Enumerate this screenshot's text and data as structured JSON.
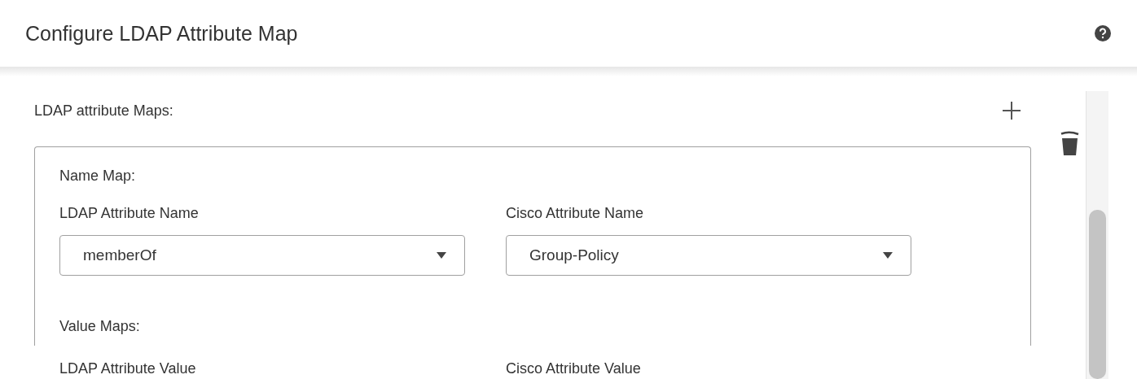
{
  "header": {
    "title": "Configure LDAP Attribute Map"
  },
  "section": {
    "label": "LDAP attribute Maps:"
  },
  "attribute_map": {
    "name_map": {
      "label": "Name Map:",
      "fields": [
        {
          "label": "LDAP Attribute Name",
          "value": "memberOf"
        },
        {
          "label": "Cisco Attribute Name",
          "value": "Group-Policy"
        }
      ]
    },
    "value_maps": {
      "label": "Value Maps:",
      "columns": [
        "LDAP Attribute Value",
        "Cisco Attribute Value"
      ]
    }
  }
}
